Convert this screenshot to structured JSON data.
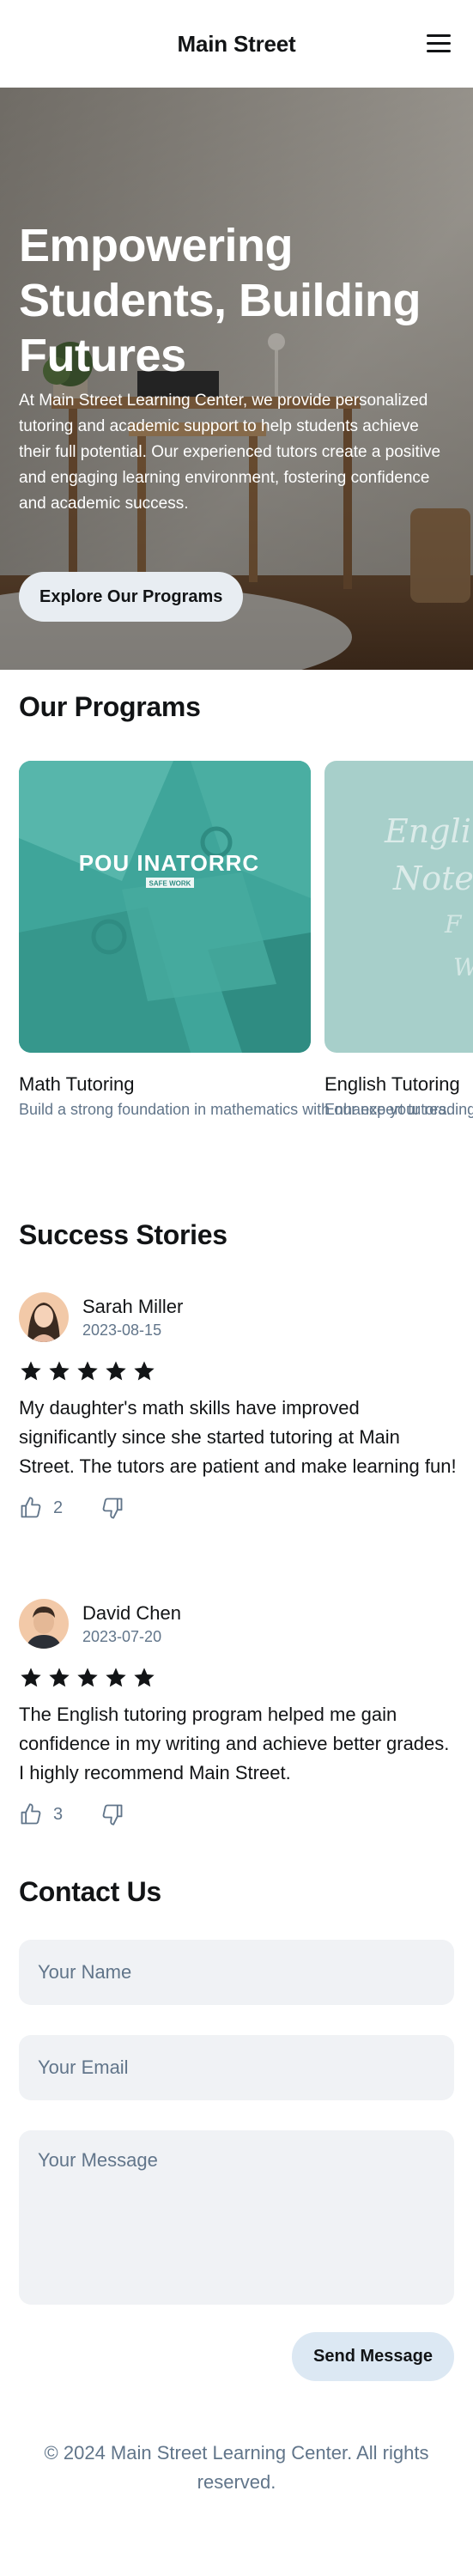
{
  "header": {
    "title": "Main Street",
    "menu_icon": "menu-icon"
  },
  "hero": {
    "title": "Empowering Students, Building Futures",
    "description": "At Main Street Learning Center, we provide personalized tutoring and academic support to help students achieve their full potential. Our experienced tutors create a positive and engaging learning environment, fostering confidence and academic success.",
    "cta_label": "Explore Our Programs",
    "cta_bg": "#e8edf2"
  },
  "programs": {
    "title": "Our Programs",
    "items": [
      {
        "name": "Math Tutoring",
        "description": "Build a strong foundation in mathematics with our expert tutors.",
        "image_text": "POU INATORRC",
        "image_subtext": "SAFE WORK"
      },
      {
        "name": "English Tutoring",
        "description": "Enhance your reading, writing, and critical thinking skills.",
        "image_text": "English Notebook"
      }
    ]
  },
  "reviews": {
    "title": "Success Stories",
    "items": [
      {
        "name": "Sarah Miller",
        "date": "2023-08-15",
        "rating": 5,
        "text": "My daughter's math skills have improved significantly since she started tutoring at Main Street. The tutors are patient and make learning fun!",
        "likes": "2"
      },
      {
        "name": "David Chen",
        "date": "2023-07-20",
        "rating": 5,
        "text": "The English tutoring program helped me gain confidence in my writing and achieve better grades. I highly recommend Main Street.",
        "likes": "3"
      }
    ]
  },
  "contact": {
    "title": "Contact Us",
    "name_placeholder": "Your Name",
    "email_placeholder": "Your Email",
    "message_placeholder": "Your Message",
    "send_label": "Send Message",
    "send_bg": "#dce8f3"
  },
  "footer": {
    "text": "© 2024 Main Street Learning Center. All rights reserved."
  },
  "colors": {
    "text": "#121416",
    "muted": "#61758a",
    "field_bg": "#f0f2f5",
    "teal": "#3fa59a"
  }
}
